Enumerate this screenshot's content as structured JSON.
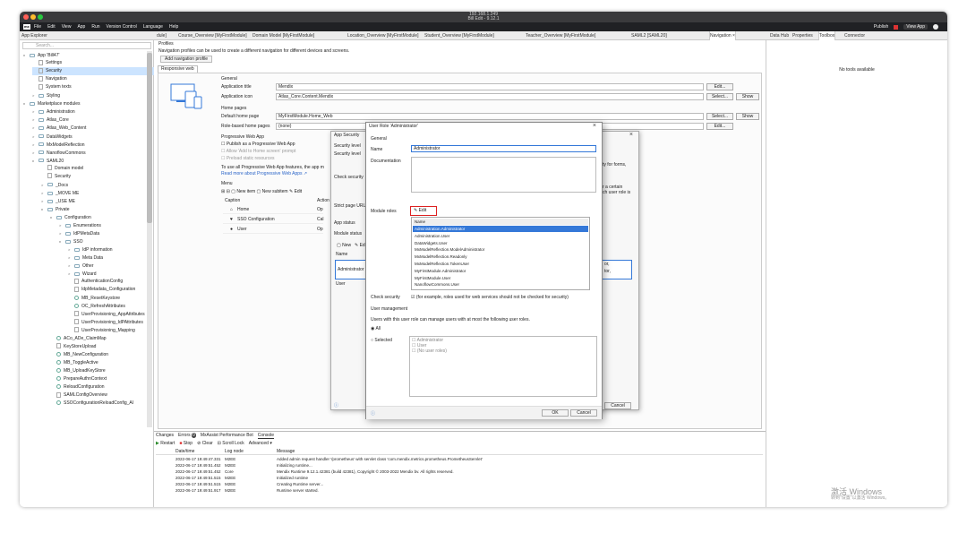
{
  "window": {
    "title": "192.168.1.249",
    "subtitle": "Bill Edit - 9.12.1"
  },
  "menu": {
    "logo": "mx",
    "items": [
      "File",
      "Edit",
      "View",
      "App",
      "Run",
      "Version Control",
      "Language",
      "Help"
    ],
    "view_app": "View App",
    "run_label": "Publish"
  },
  "tabs": {
    "left_title": "App Explorer",
    "doc_tabs": [
      "dule]",
      "Course_Overview [MyFirstModule]",
      "Domain Model [MyFirstModule]",
      "Location_Overview [MyFirstModule]",
      "Student_Overview [MyFirstModule]",
      "Teacher_Overview [MyFirstModule]",
      "SAML2 [SAML20]",
      "Navigation",
      "Data Hub",
      "Properties",
      "Toolbox",
      "Connector"
    ]
  },
  "explorer": {
    "search_placeholder": "Search...",
    "items": [
      {
        "label": "App 'Bill47'",
        "arrow": "v",
        "icon": "folder",
        "indent": 0
      },
      {
        "label": "Settings",
        "arrow": "",
        "icon": "gear",
        "indent": 1
      },
      {
        "label": "Security",
        "arrow": "",
        "icon": "shield",
        "indent": 1,
        "selected": true
      },
      {
        "label": "Navigation",
        "arrow": "",
        "icon": "nav",
        "indent": 1
      },
      {
        "label": "System texts",
        "arrow": "",
        "icon": "doc",
        "indent": 1
      },
      {
        "label": "Styling",
        "arrow": ">",
        "icon": "folder",
        "indent": 1
      },
      {
        "label": "Marketplace modules",
        "arrow": "v",
        "icon": "folder",
        "indent": 0
      },
      {
        "label": "Administration",
        "arrow": ">",
        "icon": "folder",
        "indent": 1
      },
      {
        "label": "Atlas_Core",
        "arrow": ">",
        "icon": "folder",
        "indent": 1
      },
      {
        "label": "Atlas_Web_Content",
        "arrow": ">",
        "icon": "folder",
        "indent": 1
      },
      {
        "label": "DataWidgets",
        "arrow": ">",
        "icon": "folder",
        "indent": 1
      },
      {
        "label": "MxModelReflection",
        "arrow": ">",
        "icon": "folder",
        "indent": 1
      },
      {
        "label": "NanoflowCommons",
        "arrow": ">",
        "icon": "folder",
        "indent": 1
      },
      {
        "label": "SAML20",
        "arrow": "v",
        "icon": "folder",
        "indent": 1
      },
      {
        "label": "Domain model",
        "arrow": "",
        "icon": "doc",
        "indent": 2
      },
      {
        "label": "Security",
        "arrow": "",
        "icon": "shield",
        "indent": 2
      },
      {
        "label": "_Docs",
        "arrow": ">",
        "icon": "folder",
        "indent": 2
      },
      {
        "label": "_MOVE ME",
        "arrow": ">",
        "icon": "folder",
        "indent": 2
      },
      {
        "label": "_USE ME",
        "arrow": ">",
        "icon": "folder",
        "indent": 2
      },
      {
        "label": "Private",
        "arrow": "v",
        "icon": "folder",
        "indent": 2
      },
      {
        "label": "Configuration",
        "arrow": "v",
        "icon": "folder",
        "indent": 3
      },
      {
        "label": "Enumerations",
        "arrow": ">",
        "icon": "folder",
        "indent": 4
      },
      {
        "label": "IdPMetaData",
        "arrow": ">",
        "icon": "folder",
        "indent": 4
      },
      {
        "label": "SSO",
        "arrow": "v",
        "icon": "folder",
        "indent": 4
      },
      {
        "label": "IdP information",
        "arrow": ">",
        "icon": "folder",
        "indent": 5
      },
      {
        "label": "Meta Data",
        "arrow": ">",
        "icon": "folder",
        "indent": 5
      },
      {
        "label": "Other",
        "arrow": ">",
        "icon": "folder",
        "indent": 5
      },
      {
        "label": "Wizard",
        "arrow": ">",
        "icon": "folder",
        "indent": 5
      },
      {
        "label": "AuthenticationConfig",
        "arrow": "",
        "icon": "doc",
        "indent": 5
      },
      {
        "label": "IdpMetadata_Configuration",
        "arrow": "",
        "icon": "doc",
        "indent": 5
      },
      {
        "label": "MB_ResetKeystore",
        "arrow": "",
        "icon": "circle",
        "indent": 5
      },
      {
        "label": "OC_RefreshAttributes",
        "arrow": "",
        "icon": "circle",
        "indent": 5
      },
      {
        "label": "UserProvisioning_AppAttributes",
        "arrow": "",
        "icon": "doc",
        "indent": 5
      },
      {
        "label": "UserProvisioning_IdPAttributes",
        "arrow": "",
        "icon": "doc",
        "indent": 5
      },
      {
        "label": "UserProvisioning_Mapping",
        "arrow": "",
        "icon": "doc",
        "indent": 5
      },
      {
        "label": "ACo_ADe_ClaimMap",
        "arrow": "",
        "icon": "circle",
        "indent": 3
      },
      {
        "label": "KeyStoreUpload",
        "arrow": "",
        "icon": "doc",
        "indent": 3
      },
      {
        "label": "MB_NewConfiguration",
        "arrow": "",
        "icon": "circle",
        "indent": 3
      },
      {
        "label": "MB_ToggleActive",
        "arrow": "",
        "icon": "circle",
        "indent": 3
      },
      {
        "label": "MB_UploadKeyStore",
        "arrow": "",
        "icon": "circle",
        "indent": 3
      },
      {
        "label": "PrepareAuthnContext",
        "arrow": "",
        "icon": "circle",
        "indent": 3
      },
      {
        "label": "ReloadConfiguration",
        "arrow": "",
        "icon": "circle",
        "indent": 3
      },
      {
        "label": "SAMLConfigOverview",
        "arrow": "",
        "icon": "doc",
        "indent": 3
      },
      {
        "label": "SSOConfigurationReloadConfig_AI",
        "arrow": "",
        "icon": "circle",
        "indent": 3
      }
    ]
  },
  "navigation": {
    "doc_title": "Profiles",
    "description": "Navigation profiles can be used to create a different navigation for different devices and screens.",
    "add_button": "Add navigation profile",
    "profile_tab": "Responsive web",
    "general_header": "General",
    "app_title_label": "Application title",
    "app_title_value": "Mendix",
    "app_icon_label": "Application icon",
    "app_icon_value": "Atlas_Core.Content.Mendix",
    "home_pages_header": "Home pages",
    "default_home_label": "Default home page",
    "default_home_value": "MyFirstModule.Home_Web",
    "role_home_label": "Role-based home pages",
    "role_home_value": "(none)",
    "pwa_header": "Progressive Web App",
    "pwa_publish": "Publish as a Progressive Web App",
    "pwa_add_home": "Allow 'Add to Home screen' prompt",
    "pwa_preload": "Preload static resources",
    "pwa_note": "To use all Progressive Web App features, the app m",
    "pwa_link": "Read more about Progressive Web Apps",
    "menu_header": "Menu",
    "new_item": "New item",
    "new_subitem": "New subitem",
    "edit": "Edit",
    "col_caption": "Caption",
    "col_action": "Action",
    "menu_rows": [
      {
        "caption": "Home",
        "action": "Op"
      },
      {
        "caption": "SSO Configuration",
        "action": "Cal"
      },
      {
        "caption": "User",
        "action": "Op"
      }
    ],
    "edit_btn": "Edit...",
    "show_btn": "Show",
    "select_btn": "Select..."
  },
  "dlg_security": {
    "title": "App Security",
    "security_level": "Security level",
    "check_security": "Check security",
    "strict_page": "Strict page URL",
    "app_status": "App status",
    "module_status": "Module status",
    "new_btn": "New",
    "edit_btn": "Ed",
    "name_col": "Name",
    "admin": "Administrator",
    "user": "User",
    "side_text1": "ty for forms,",
    "side_text2": "r a certain",
    "side_text3": "ch user role is",
    "right_cell1": "or,",
    "right_cell2": "tor,",
    "cancel": "Cancel"
  },
  "dlg_role": {
    "title": "User Role 'Administrator'",
    "general": "General",
    "name_label": "Name",
    "name_value": "Administrator",
    "documentation_label": "Documentation",
    "module_roles_label": "Module roles",
    "edit_button": "Edit",
    "list_header": "Name",
    "module_roles": [
      "Administration.Administrator",
      "Administration.User",
      "DataWidgets.User",
      "MxModelReflection.ModelAdministrator",
      "MxModelReflection.Readonly",
      "MxModelReflection.TokenUser",
      "MyFirstModule.Administrator",
      "MyFirstModule.User",
      "NanoflowCommons.User"
    ],
    "check_security_label": "Check security",
    "check_security_text": "(for example, roles used for web services should not be checked for security)",
    "user_mgmt_header": "User management",
    "user_mgmt_text": "Users with this user role can manage users with at most the following user roles.",
    "radio_all": "All",
    "radio_selected": "Selected",
    "selected_options": [
      "Administrator",
      "User",
      "(No user roles)"
    ],
    "ok": "OK",
    "cancel": "Cancel"
  },
  "bottom": {
    "tabs": [
      "Changes",
      "Errors",
      "MxAssist Performance Bot",
      "Console"
    ],
    "error_count": "0",
    "restart": "Restart",
    "stop": "Stop",
    "clear": "Clear",
    "scroll_lock": "Scroll Lock",
    "advanced": "Advanced",
    "cols": [
      "Date/time",
      "Log node",
      "Message"
    ],
    "rows": [
      [
        "2022-06-17 19:49:47.331",
        "M2EE",
        "Added admin request handler '/prometheus' with servlet class 'com.mendix.metrics.prometheus.PrometheusServlet'"
      ],
      [
        "2022-06-17 19:49:51.452",
        "M2EE",
        "Initializing runtime..."
      ],
      [
        "2022-06-17 19:49:51.452",
        "Core",
        "Mendix Runtime 9.12.1.42381 (build 42381), Copyright © 2003-2022 Mendix bv. All rights reserved."
      ],
      [
        "2022-06-17 19:49:51.515",
        "M2EE",
        "Initialized runtime"
      ],
      [
        "2022-06-17 19:49:51.515",
        "M2EE",
        "Creating Runtime server..."
      ],
      [
        "2022-06-17 19:49:51.917",
        "M2EE",
        "Runtime server started."
      ]
    ]
  },
  "right": {
    "no_tools": "No tools available"
  },
  "watermark": {
    "line1": "激活 Windows",
    "line2": "转到\"设置\"以激活 Windows。"
  },
  "colors": {
    "accent": "#3478d8",
    "selection": "#cce4ff",
    "titlebar": "#3a3a3c",
    "highlight_red": "#dd2222"
  }
}
